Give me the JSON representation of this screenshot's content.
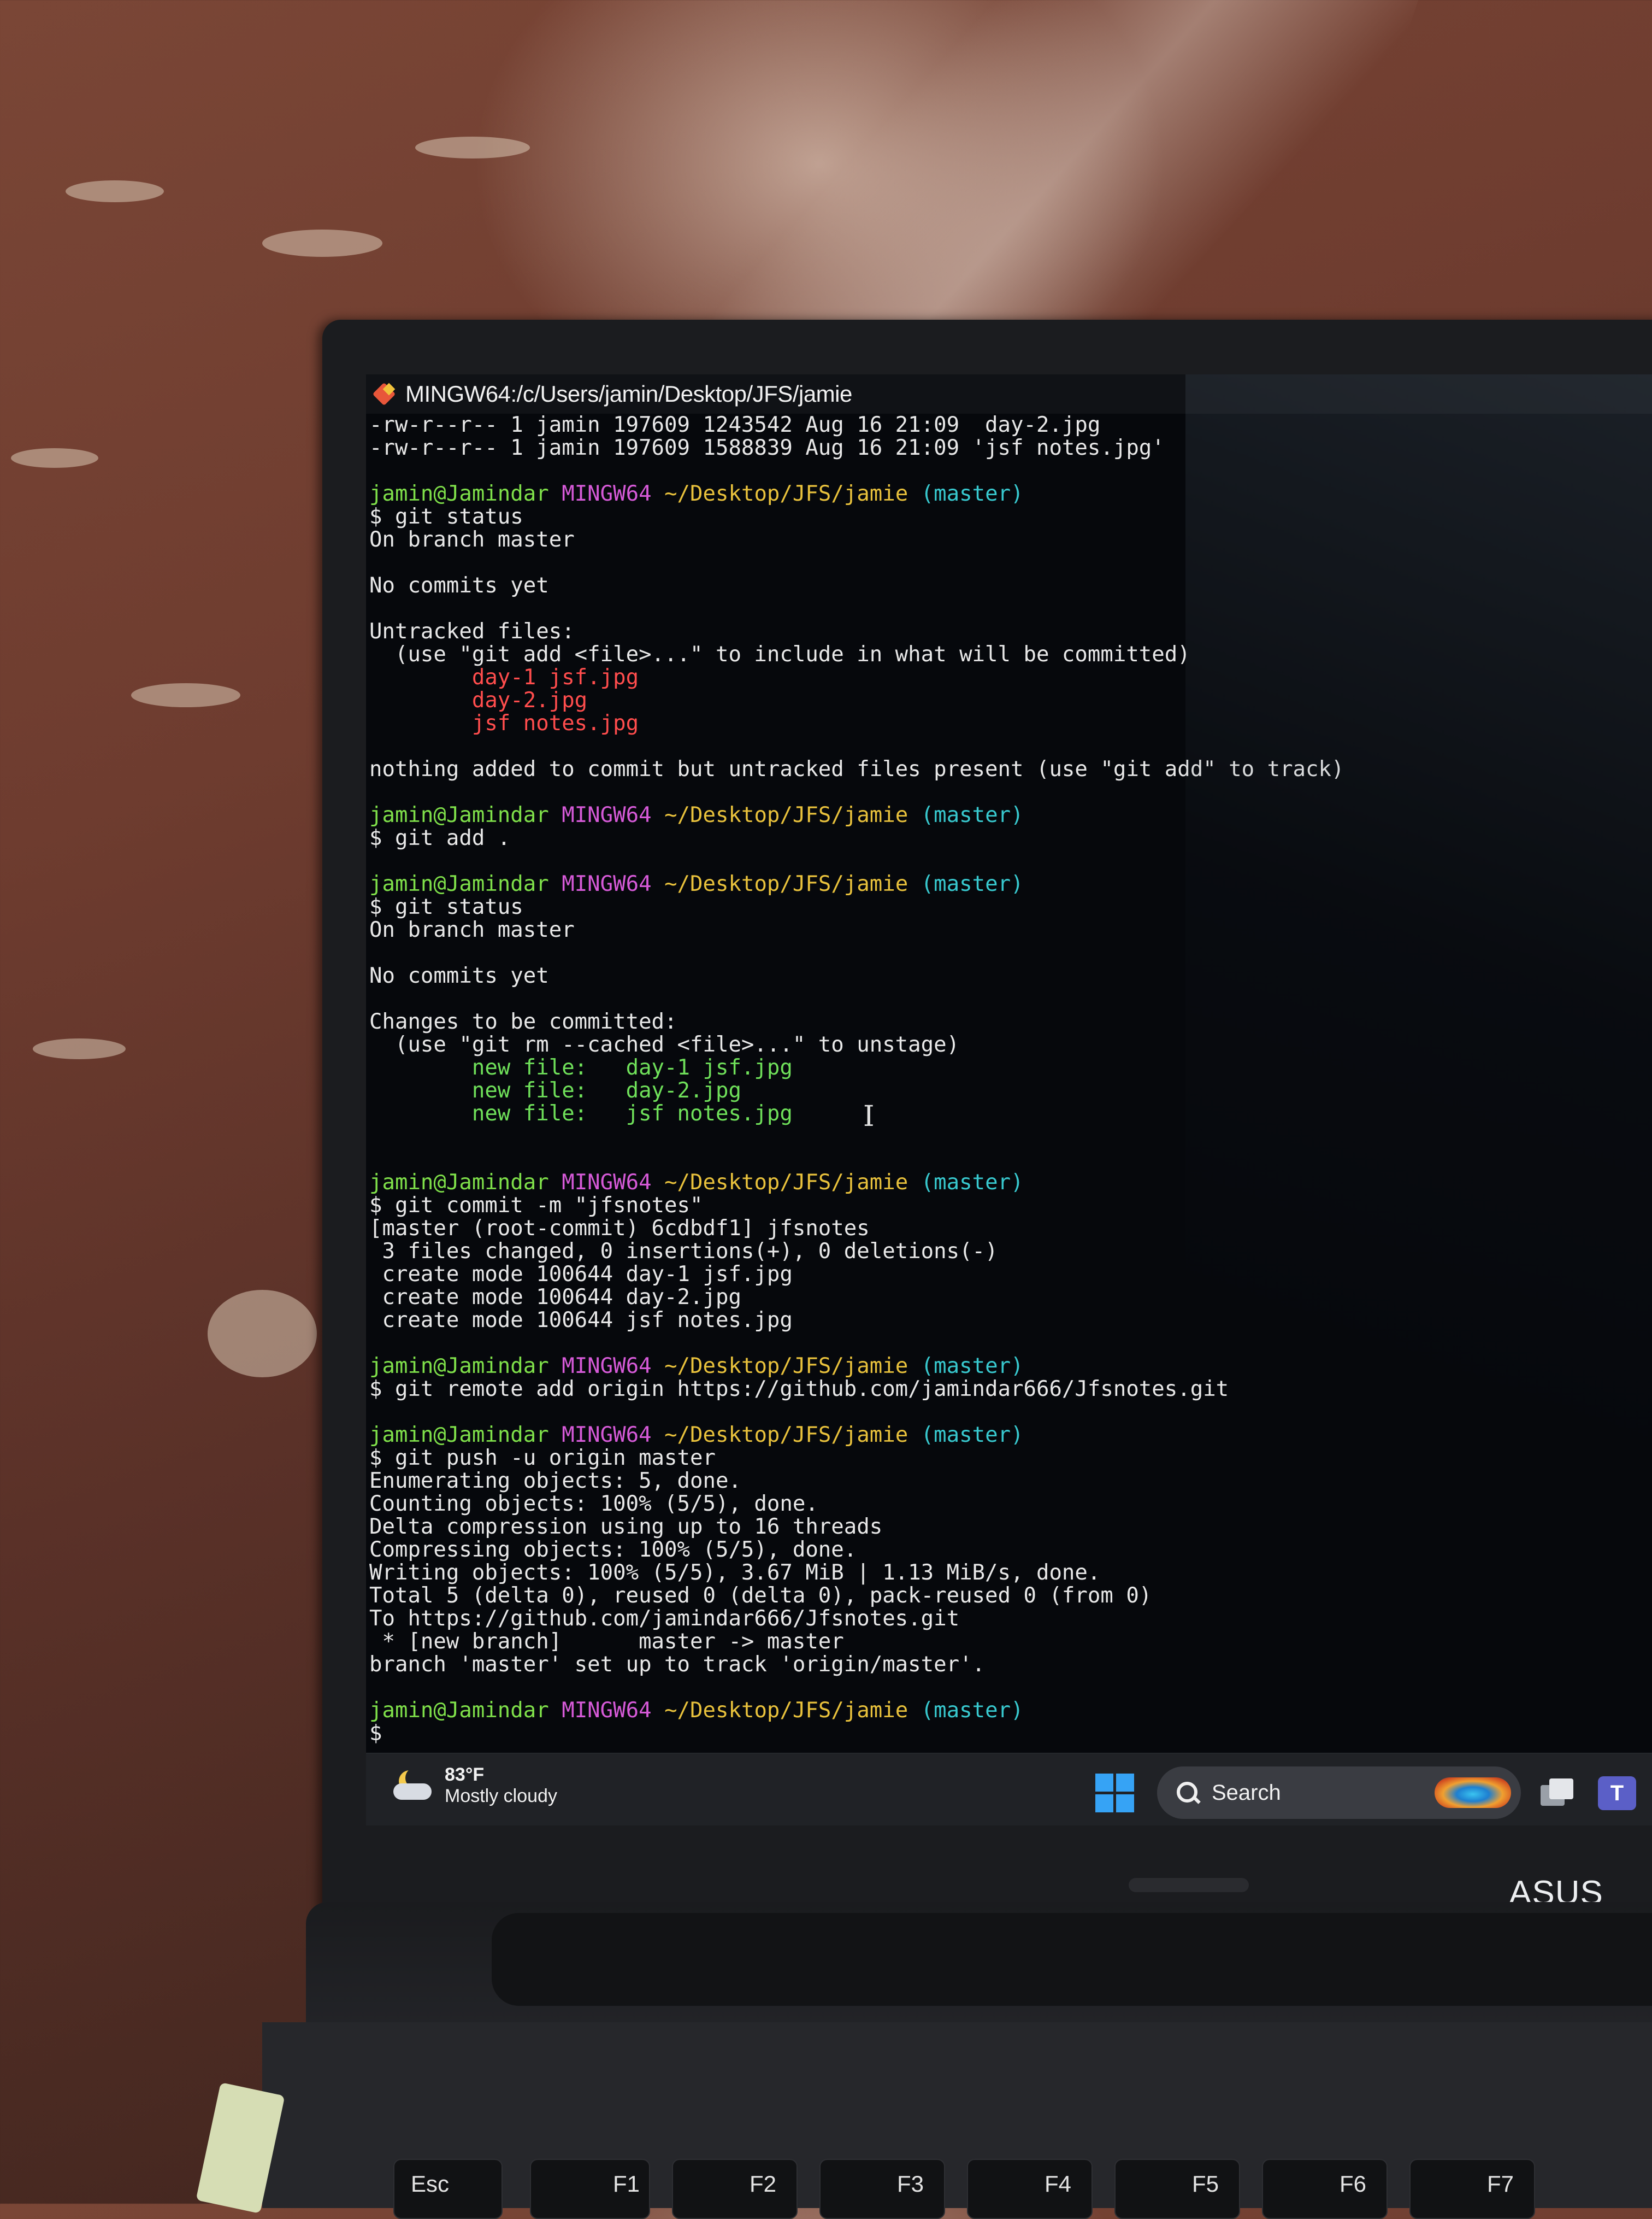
{
  "window": {
    "title": "MINGW64:/c/Users/jamin/Desktop/JFS/jamie"
  },
  "prompt": {
    "user": "jamin@Jamindar",
    "system": "MINGW64",
    "path": "~/Desktop/JFS/jamie",
    "branch": "(master)"
  },
  "terminal": {
    "ls_lines": [
      "-rw-r--r-- 1 jamin 197609 1243542 Aug 16 21:09  day-2.jpg",
      "-rw-r--r-- 1 jamin 197609 1588839 Aug 16 21:09 'jsf notes.jpg'"
    ],
    "cmd1": "$ git status",
    "status1": [
      "On branch master",
      "",
      "No commits yet",
      "",
      "Untracked files:",
      "  (use \"git add <file>...\" to include in what will be committed)"
    ],
    "untracked": [
      "        day-1 jsf.jpg",
      "        day-2.jpg",
      "        jsf notes.jpg"
    ],
    "nothing_added": "nothing added to commit but untracked files present (use \"git add\" to track)",
    "cmd2": "$ git add .",
    "cmd3": "$ git status",
    "status2": [
      "On branch master",
      "",
      "No commits yet",
      "",
      "Changes to be committed:",
      "  (use \"git rm --cached <file>...\" to unstage)"
    ],
    "staged": [
      "        new file:   day-1 jsf.jpg",
      "        new file:   day-2.jpg",
      "        new file:   jsf notes.jpg"
    ],
    "cmd4": "$ git commit -m \"jfsnotes\"",
    "commit_out": [
      "[master (root-commit) 6cdbdf1] jfsnotes",
      " 3 files changed, 0 insertions(+), 0 deletions(-)",
      " create mode 100644 day-1 jsf.jpg",
      " create mode 100644 day-2.jpg",
      " create mode 100644 jsf notes.jpg"
    ],
    "cmd5": "$ git remote add origin https://github.com/jamindar666/Jfsnotes.git",
    "cmd6": "$ git push -u origin master",
    "push_out": [
      "Enumerating objects: 5, done.",
      "Counting objects: 100% (5/5), done.",
      "Delta compression using up to 16 threads",
      "Compressing objects: 100% (5/5), done.",
      "Writing objects: 100% (5/5), 3.67 MiB | 1.13 MiB/s, done.",
      "Total 5 (delta 0), reused 0 (delta 0), pack-reused 0 (from 0)",
      "To https://github.com/jamindar666/Jfsnotes.git",
      " * [new branch]      master -> master",
      "branch 'master' set up to track 'origin/master'."
    ],
    "final_prompt": "$"
  },
  "taskbar": {
    "temperature": "83°F",
    "weather": "Mostly cloudy",
    "search_label": "Search",
    "weather_icon": "moon-cloud-icon",
    "start_icon": "windows-start-icon"
  },
  "keyboard": {
    "keys": [
      "Esc",
      "F1",
      "F2",
      "F3",
      "F4",
      "F5",
      "F6",
      "F7"
    ]
  },
  "brand": "ASUS Viv",
  "colors": {
    "prompt_user": "#7fe04a",
    "prompt_system": "#d65ad8",
    "prompt_path": "#e8c13c",
    "prompt_branch": "#38c9cf",
    "untracked": "#ff4d4d",
    "staged": "#6fe05a"
  }
}
